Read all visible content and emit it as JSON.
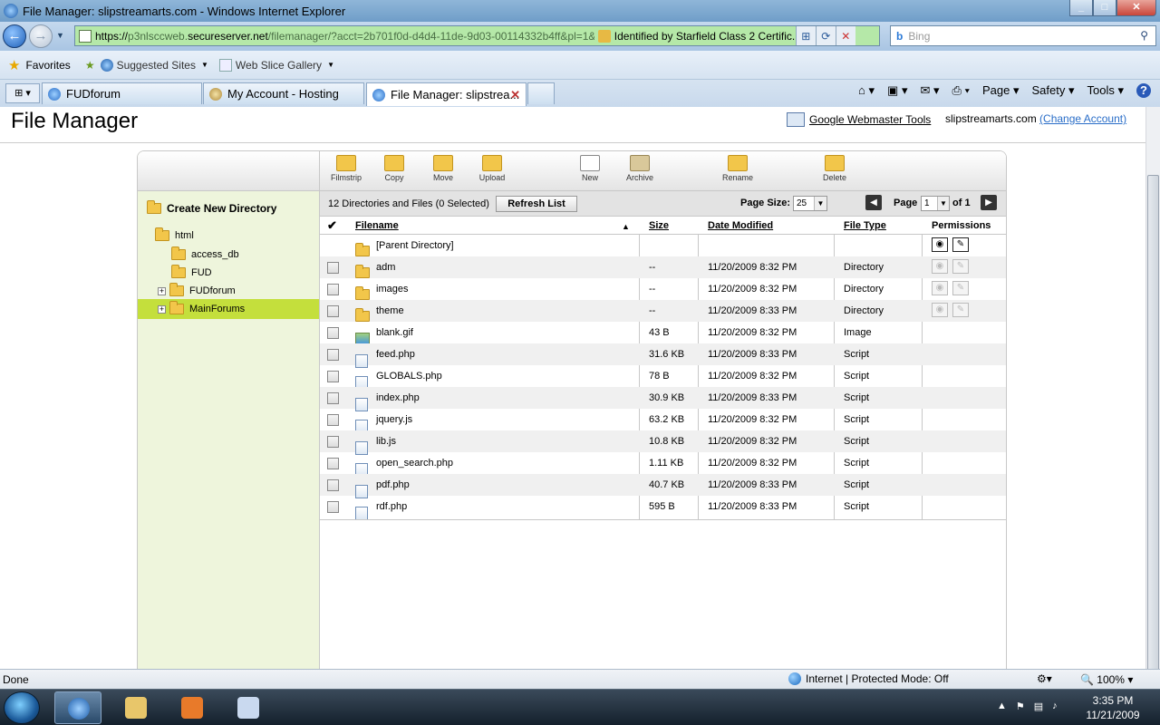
{
  "window": {
    "title": "File Manager: slipstreamarts.com - Windows Internet Explorer"
  },
  "address": {
    "scheme": "https://",
    "host_prefix": "p3nlsccweb.",
    "host": "secureserver.net",
    "path": "/filemanager/?acct=2b701f0d-d4d4-11de-9d03-00114332b4ff&pl=1&",
    "identity": "Identified by Starfield Class 2 Certific..."
  },
  "search": {
    "placeholder": "Bing"
  },
  "favorites": {
    "favorites_label": "Favorites",
    "suggested_label": "Suggested Sites",
    "webslice_label": "Web Slice Gallery"
  },
  "tabs": [
    {
      "label": "FUDforum"
    },
    {
      "label": "My Account - Hosting"
    },
    {
      "label": "File Manager: slipstrea..."
    }
  ],
  "commandbar": {
    "page": "Page",
    "safety": "Safety",
    "tools": "Tools"
  },
  "page": {
    "title": "File Manager",
    "webmaster_tools": "Google Webmaster Tools",
    "account": "slipstreamarts.com",
    "change_account": "(Change Account)"
  },
  "toolbar": {
    "filmstrip": "Filmstrip",
    "copy": "Copy",
    "move": "Move",
    "upload": "Upload",
    "new": "New",
    "archive": "Archive",
    "rename": "Rename",
    "delete": "Delete"
  },
  "sidebar": {
    "create_new_directory": "Create New Directory",
    "tree": [
      {
        "label": "html"
      },
      {
        "label": "access_db"
      },
      {
        "label": "FUD"
      },
      {
        "label": "FUDforum"
      },
      {
        "label": "MainForums"
      }
    ]
  },
  "info": {
    "count": "12 Directories and Files (0 Selected)",
    "refresh": "Refresh List",
    "page_size_label": "Page Size:",
    "page_size": "25",
    "page_label": "Page",
    "page_num": "1",
    "page_of": "of 1"
  },
  "columns": {
    "filename": "Filename",
    "size": "Size",
    "date": "Date Modified",
    "type": "File Type",
    "permissions": "Permissions"
  },
  "parent_dir": "[Parent Directory]",
  "files": [
    {
      "name": "adm",
      "size": "--",
      "date": "11/20/2009 8:32 PM",
      "type": "Directory",
      "kind": "folder"
    },
    {
      "name": "images",
      "size": "--",
      "date": "11/20/2009 8:32 PM",
      "type": "Directory",
      "kind": "folder"
    },
    {
      "name": "theme",
      "size": "--",
      "date": "11/20/2009 8:33 PM",
      "type": "Directory",
      "kind": "folder"
    },
    {
      "name": "blank.gif",
      "size": "43 B",
      "date": "11/20/2009 8:32 PM",
      "type": "Image",
      "kind": "image"
    },
    {
      "name": "feed.php",
      "size": "31.6 KB",
      "date": "11/20/2009 8:33 PM",
      "type": "Script",
      "kind": "file"
    },
    {
      "name": "GLOBALS.php",
      "size": "78 B",
      "date": "11/20/2009 8:32 PM",
      "type": "Script",
      "kind": "file"
    },
    {
      "name": "index.php",
      "size": "30.9 KB",
      "date": "11/20/2009 8:33 PM",
      "type": "Script",
      "kind": "file"
    },
    {
      "name": "jquery.js",
      "size": "63.2 KB",
      "date": "11/20/2009 8:32 PM",
      "type": "Script",
      "kind": "file"
    },
    {
      "name": "lib.js",
      "size": "10.8 KB",
      "date": "11/20/2009 8:32 PM",
      "type": "Script",
      "kind": "file"
    },
    {
      "name": "open_search.php",
      "size": "1.11 KB",
      "date": "11/20/2009 8:32 PM",
      "type": "Script",
      "kind": "file"
    },
    {
      "name": "pdf.php",
      "size": "40.7 KB",
      "date": "11/20/2009 8:33 PM",
      "type": "Script",
      "kind": "file"
    },
    {
      "name": "rdf.php",
      "size": "595 B",
      "date": "11/20/2009 8:33 PM",
      "type": "Script",
      "kind": "file"
    }
  ],
  "status": {
    "left": "Done",
    "zone": "Internet | Protected Mode: Off",
    "zoom": "100%"
  },
  "clock": {
    "time": "3:35 PM",
    "date": "11/21/2009"
  }
}
